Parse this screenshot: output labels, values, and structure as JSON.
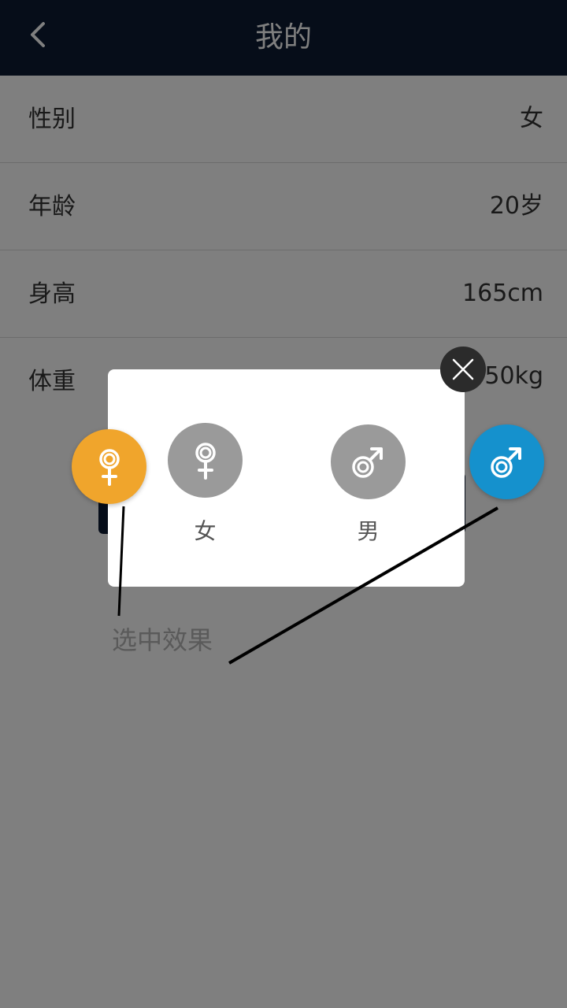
{
  "header": {
    "title": "我的",
    "back_icon": "chevron-left-icon"
  },
  "profile": {
    "rows": [
      {
        "label": "性别",
        "value": "女"
      },
      {
        "label": "年龄",
        "value": "20岁"
      },
      {
        "label": "身高",
        "value": "165cm"
      },
      {
        "label": "体重",
        "value": "50kg"
      }
    ]
  },
  "gender_dialog": {
    "options": [
      {
        "label": "女",
        "icon": "female-icon"
      },
      {
        "label": "男",
        "icon": "male-icon"
      }
    ],
    "close_icon": "close-icon"
  },
  "selected_effects": {
    "female_color": "#F0A52C",
    "male_color": "#1591CD"
  },
  "annotation": {
    "text": "选中效果"
  },
  "colors": {
    "header_bg": "#0C1A33",
    "option_gray": "#9A9A9A",
    "overlay": "rgba(0,0,0,0.5)"
  }
}
